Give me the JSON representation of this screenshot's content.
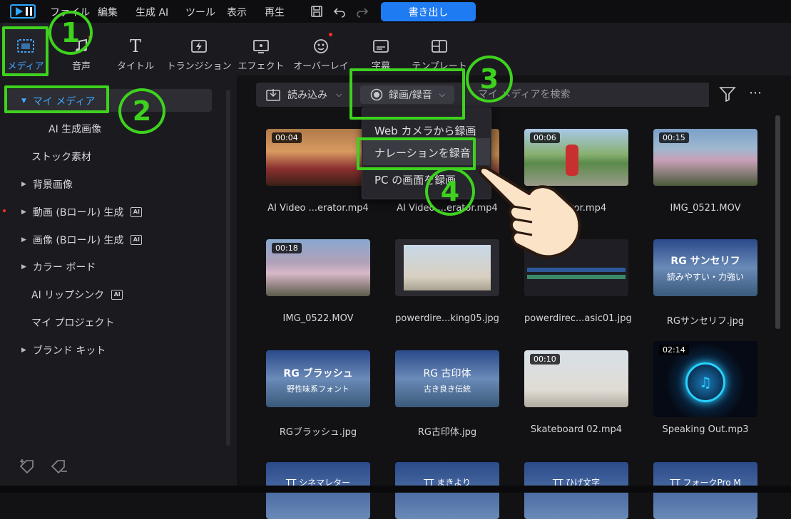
{
  "menubar": {
    "items": [
      "ファイル",
      "編集",
      "生成 AI",
      "ツール",
      "表示",
      "再生"
    ],
    "export_label": "書き出し"
  },
  "ribbon": {
    "tabs": [
      {
        "label": "メディア",
        "icon": "media-icon",
        "active": true
      },
      {
        "label": "音声",
        "icon": "music-note-icon"
      },
      {
        "label": "タイトル",
        "icon": "title-t-icon"
      },
      {
        "label": "トランジション",
        "icon": "transition-icon"
      },
      {
        "label": "エフェクト",
        "icon": "effect-icon"
      },
      {
        "label": "オーバーレイ",
        "icon": "overlay-icon"
      },
      {
        "label": "字幕",
        "icon": "subtitle-icon"
      },
      {
        "label": "テンプレート",
        "icon": "template-icon"
      }
    ]
  },
  "sidebar": {
    "items": [
      {
        "label": "マイ メディア",
        "expanded": true,
        "selected": true
      },
      {
        "label": "AI 生成画像"
      },
      {
        "label": "ストック素材"
      },
      {
        "label": "背景画像"
      },
      {
        "label": "動画 (Bロール) 生成",
        "ai": true
      },
      {
        "label": "画像 (Bロール) 生成",
        "ai": true
      },
      {
        "label": "カラー ボード"
      },
      {
        "label": "AI リップシンク",
        "ai": true
      },
      {
        "label": "マイ プロジェクト"
      },
      {
        "label": "ブランド キット"
      }
    ],
    "ai_badge": "AI"
  },
  "toolbar": {
    "import_label": "読み込み",
    "record_label": "録画/録音",
    "search_placeholder": "マイ メディアを検索"
  },
  "dropdown": {
    "items": [
      "Web カメラから録画",
      "ナレーションを録音",
      "PC の画面を録画"
    ]
  },
  "media": [
    {
      "name": "AI Video ...erator.mp4",
      "duration": "00:04"
    },
    {
      "name": "AI Video ...erator.mp4",
      "duration": ""
    },
    {
      "name": "...erator.mp4",
      "duration": "00:06"
    },
    {
      "name": "IMG_0521.MOV",
      "duration": "00:15"
    },
    {
      "name": "IMG_0522.MOV",
      "duration": "00:18"
    },
    {
      "name": "powerdire...king05.jpg",
      "duration": ""
    },
    {
      "name": "powerdirec...asic01.jpg",
      "duration": ""
    },
    {
      "name": "RGサンセリフ.jpg",
      "duration": ""
    },
    {
      "name": "RGブラッシュ.jpg",
      "duration": ""
    },
    {
      "name": "RG古印体.jpg",
      "duration": ""
    },
    {
      "name": "Skateboard 02.mp4",
      "duration": "00:10"
    },
    {
      "name": "Speaking Out.mp3",
      "duration": "02:14"
    },
    {
      "name": "",
      "duration": ""
    },
    {
      "name": "",
      "duration": ""
    },
    {
      "name": "",
      "duration": ""
    },
    {
      "name": "",
      "duration": ""
    }
  ],
  "thumb_text": {
    "sanserif_title": "RG サンセリフ",
    "sanserif_sub": "読みやすい・力強い",
    "brush_title": "RG ブラッシュ",
    "brush_sub": "野性味系フォント",
    "kointai_title": "RG 古印体",
    "kointai_sub": "古き良き伝統",
    "row4_a": "TT シネマレター",
    "row4_b": "TT まきより",
    "row4_c": "TT ひげ文字",
    "row4_d": "TT フォークPro M"
  },
  "annotations": {
    "steps": [
      "1",
      "2",
      "3",
      "4"
    ],
    "color": "#3ed21e"
  },
  "colors": {
    "accent": "#1f7bf2",
    "active_tab_label": "#43a6ff",
    "highlight": "#3ed21e"
  }
}
